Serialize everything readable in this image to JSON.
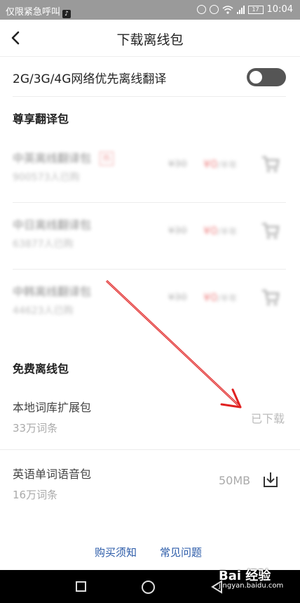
{
  "statusbar": {
    "left_text": "仅限紧急呼叫",
    "battery": "17",
    "time": "10:04"
  },
  "header": {
    "title": "下载离线包"
  },
  "settings": {
    "network_pref_label": "2G/3G/4G网络优先离线翻译",
    "network_pref_on": false
  },
  "premium": {
    "section_title": "尊享翻译包",
    "packages": [
      {
        "name": "中英离线翻译包",
        "buyers": "900573人已购",
        "old_price": "¥30",
        "price": "¥0",
        "unit": "/半年",
        "hot": "热"
      },
      {
        "name": "中日离线翻译包",
        "buyers": "63877人已购",
        "old_price": "¥30",
        "price": "¥0",
        "unit": "/半年"
      },
      {
        "name": "中韩离线翻译包",
        "buyers": "44623人已购",
        "old_price": "¥30",
        "price": "¥0",
        "unit": "/半年"
      }
    ]
  },
  "free": {
    "section_title": "免费离线包",
    "packages": [
      {
        "name": "本地词库扩展包",
        "sub": "33万词条",
        "status": "已下载"
      },
      {
        "name": "英语单词语音包",
        "sub": "16万词条",
        "size": "50MB"
      }
    ]
  },
  "links": {
    "purchase_notes": "购买须知",
    "faq": "常见问题"
  },
  "watermark": {
    "brand": "Bai 经验",
    "url": "jingyan.baidu.com"
  },
  "colors": {
    "accent_red": "#e02d2d",
    "link_blue": "#2a5aa8",
    "annotation_red": "#e02020"
  }
}
